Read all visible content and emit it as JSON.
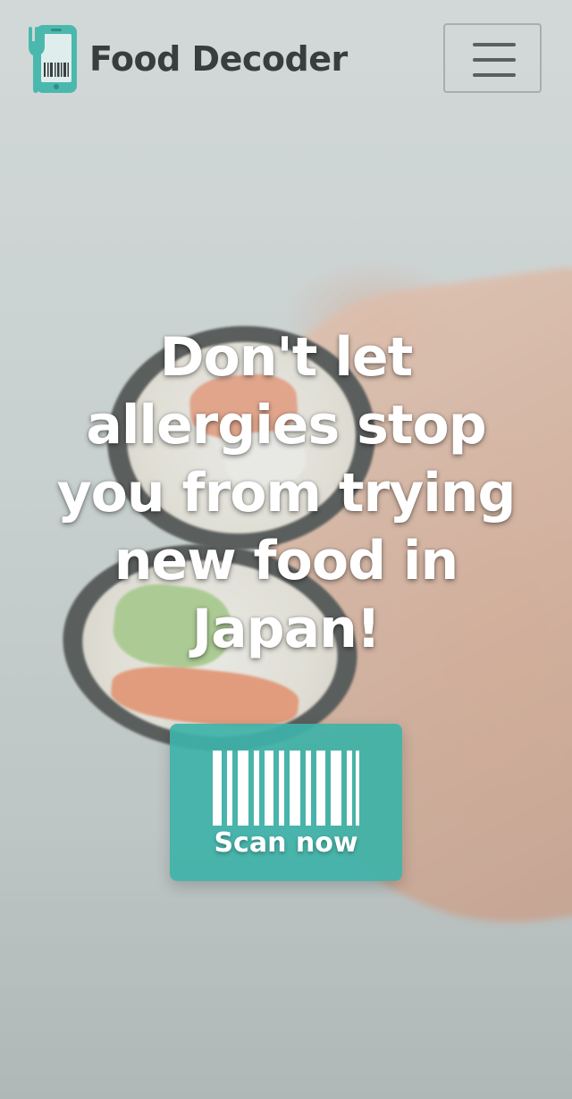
{
  "colors": {
    "brand_teal": "#4bb8ae",
    "scan_button": "#3eb2a8",
    "brand_text": "#3a3d3e",
    "hero_text": "#ffffff"
  },
  "header": {
    "logo_icon": "phone-fork-barcode-icon",
    "brand_name": "Food Decoder",
    "menu_icon": "hamburger-menu-icon"
  },
  "hero": {
    "headline": "Don't let allergies stop you from trying new food in Japan!",
    "scan_button": {
      "icon": "barcode-icon",
      "label": "Scan now"
    }
  }
}
